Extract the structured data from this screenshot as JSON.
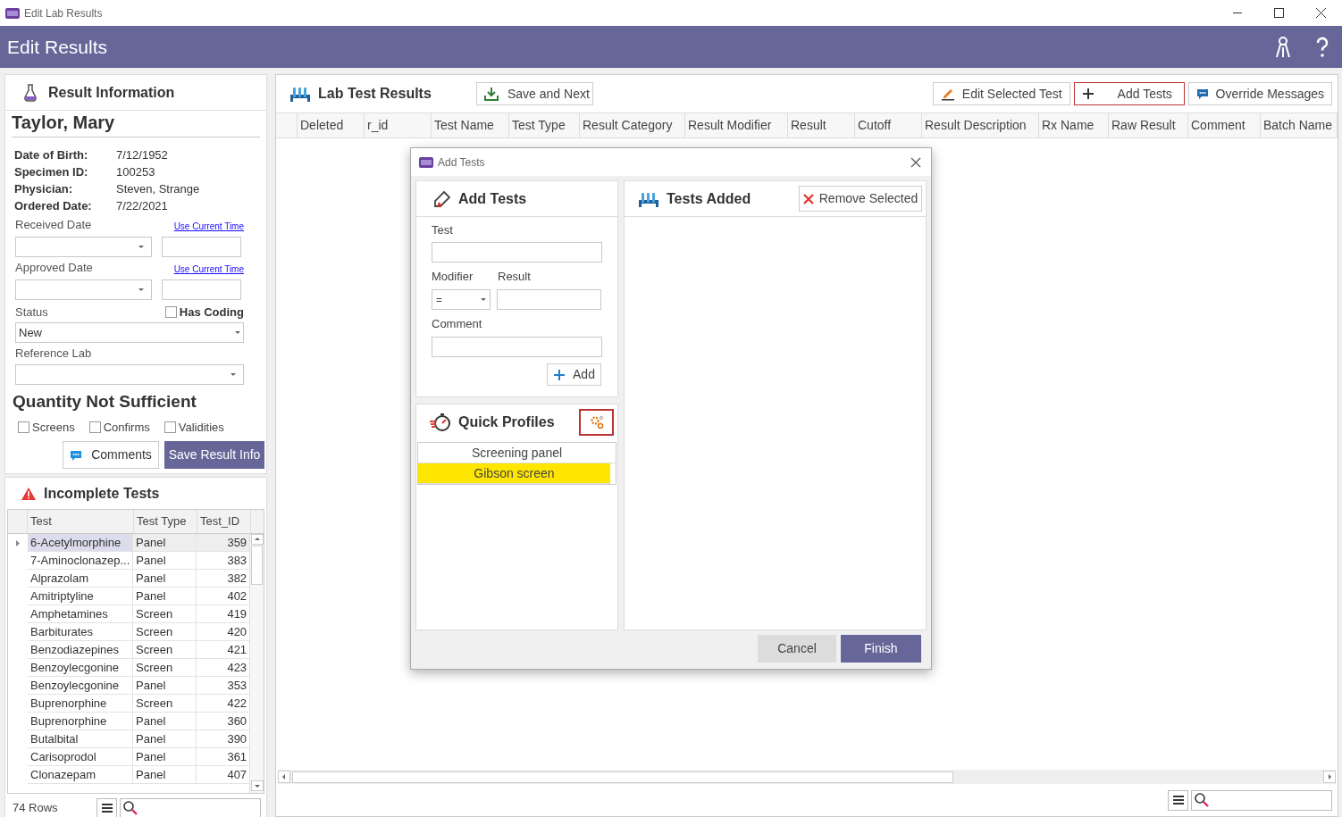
{
  "window": {
    "title": "Edit Lab Results"
  },
  "header": {
    "title": "Edit Results"
  },
  "result_info": {
    "title": "Result Information",
    "patient": "Taylor, Mary",
    "fields": [
      {
        "label": "Date of Birth:",
        "value": "7/12/1952"
      },
      {
        "label": "Specimen ID:",
        "value": "100253"
      },
      {
        "label": "Physician:",
        "value": "Steven, Strange"
      },
      {
        "label": "Ordered Date:",
        "value": "7/22/2021"
      }
    ],
    "dates": [
      {
        "label": "Received Date",
        "link": "Use Current Time"
      },
      {
        "label": "Approved Date",
        "link": "Use Current Time"
      }
    ],
    "status": {
      "label": "Status",
      "value": "New"
    },
    "has_coding": {
      "label": "Has Coding",
      "checked": false
    },
    "reference_lab": {
      "label": "Reference Lab"
    },
    "qns": {
      "title": "Quantity Not Sufficient",
      "options": [
        {
          "label": "Screens",
          "checked": false
        },
        {
          "label": "Confirms",
          "checked": false
        },
        {
          "label": "Validities",
          "checked": false
        }
      ]
    },
    "buttons": [
      {
        "label": "Comments",
        "kind": "comment"
      },
      {
        "label": "Save Result Info",
        "kind": "primary"
      }
    ]
  },
  "incomplete_tests": {
    "title": "Incomplete Tests",
    "columns": [
      "Test",
      "Test Type",
      "Test_ID"
    ],
    "rows": [
      {
        "test": "6-Acetylmorphine",
        "type": "Panel",
        "id": "359",
        "selected": true
      },
      {
        "test": "7-Aminoclonazep...",
        "type": "Panel",
        "id": "383",
        "selected": false
      },
      {
        "test": "Alprazolam",
        "type": "Panel",
        "id": "382",
        "selected": false
      },
      {
        "test": "Amitriptyline",
        "type": "Panel",
        "id": "402",
        "selected": false
      },
      {
        "test": "Amphetamines",
        "type": "Screen",
        "id": "419",
        "selected": false
      },
      {
        "test": "Barbiturates",
        "type": "Screen",
        "id": "420",
        "selected": false
      },
      {
        "test": "Benzodiazepines",
        "type": "Screen",
        "id": "421",
        "selected": false
      },
      {
        "test": "Benzoylecgonine",
        "type": "Screen",
        "id": "423",
        "selected": false
      },
      {
        "test": "Benzoylecgonine",
        "type": "Panel",
        "id": "353",
        "selected": false
      },
      {
        "test": "Buprenorphine",
        "type": "Screen",
        "id": "422",
        "selected": false
      },
      {
        "test": "Buprenorphine",
        "type": "Panel",
        "id": "360",
        "selected": false
      },
      {
        "test": "Butalbital",
        "type": "Panel",
        "id": "390",
        "selected": false
      },
      {
        "test": "Carisoprodol",
        "type": "Panel",
        "id": "361",
        "selected": false
      },
      {
        "test": "Clonazepam",
        "type": "Panel",
        "id": "407",
        "selected": false
      }
    ],
    "row_count": "74 Rows"
  },
  "lab_results": {
    "title": "Lab Test Results",
    "buttons": [
      {
        "label": "Save and Next",
        "kind": "download",
        "focused": false
      },
      {
        "label": "Edit Selected Test",
        "kind": "edit",
        "focused": false
      },
      {
        "label": "Add Tests",
        "kind": "plus",
        "focused": true
      },
      {
        "label": "Override Messages",
        "kind": "message",
        "focused": false
      }
    ],
    "columns": [
      "Deleted",
      "r_id",
      "Test Name",
      "Test Type",
      "Result Category",
      "Result Modifier",
      "Result",
      "Cutoff",
      "Result Description",
      "Rx Name",
      "Raw Result",
      "Comment",
      "Batch Name"
    ]
  },
  "dialog": {
    "title": "Add Tests",
    "add_panel": {
      "title": "Add Tests",
      "test_label": "Test",
      "modifier_label": "Modifier",
      "modifier_value": "=",
      "result_label": "Result",
      "comment_label": "Comment",
      "add_button": "Add"
    },
    "profiles": {
      "title": "Quick Profiles",
      "items": [
        {
          "label": "Screening panel",
          "selected": false
        },
        {
          "label": "Gibson screen",
          "selected": true
        }
      ]
    },
    "added": {
      "title": "Tests Added",
      "remove_button": "Remove Selected"
    },
    "buttons": [
      {
        "label": "Cancel",
        "kind": "secondary"
      },
      {
        "label": "Finish",
        "kind": "primary"
      }
    ]
  }
}
